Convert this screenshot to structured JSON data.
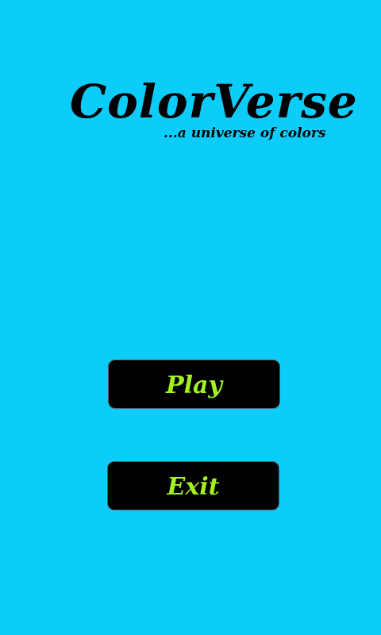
{
  "app": {
    "title": "ColorVerse",
    "subtitle": "...a universe of colors"
  },
  "menu": {
    "play_label": "Play",
    "exit_label": "Exit"
  },
  "colors": {
    "background": "#0CCDF9",
    "button_background": "#000000",
    "button_text": "#A2F21F",
    "title_text": "#000000"
  }
}
